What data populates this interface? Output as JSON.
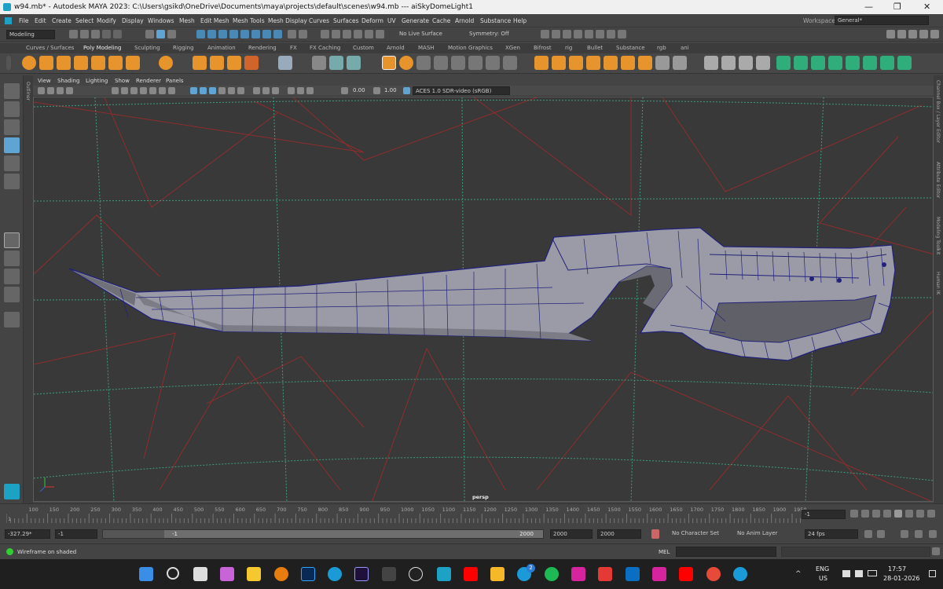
{
  "titlebar": {
    "title": "w94.mb* - Autodesk MAYA 2023: C:\\Users\\gsikd\\OneDrive\\Documents\\maya\\projects\\default\\scenes\\w94.mb   ---   aiSkyDomeLight1",
    "minimize": "—",
    "restore": "❐",
    "close": "✕"
  },
  "menu": [
    "File",
    "Edit",
    "Create",
    "Select",
    "Modify",
    "Display",
    "Windows",
    "Mesh",
    "Edit Mesh",
    "Mesh Tools",
    "Mesh Display",
    "Curves",
    "Surfaces",
    "Deform",
    "UV",
    "Generate",
    "Cache",
    "Arnold",
    "Substance",
    "Help"
  ],
  "workspace": {
    "label": "Workspace :",
    "value": "General*"
  },
  "status": {
    "mode": "Modeling",
    "live_surface": "No Live Surface",
    "symmetry": "Symmetry: Off"
  },
  "shelf_tabs": [
    "Curves / Surfaces",
    "Poly Modeling",
    "Sculpting",
    "Rigging",
    "Animation",
    "Rendering",
    "FX",
    "FX Caching",
    "Custom",
    "Arnold",
    "MASH",
    "Motion Graphics",
    "XGen",
    "Bifrost",
    "rig",
    "Bullet",
    "Substance",
    "rgb",
    "ani"
  ],
  "shelf_active": "Poly Modeling",
  "side_tabs": {
    "left": "Outliner",
    "right": [
      "Channel Box / Layer Editor",
      "Attribute Editor",
      "Modeling Toolkit",
      "Human IK"
    ]
  },
  "viewport": {
    "menu": [
      "View",
      "Shading",
      "Lighting",
      "Show",
      "Renderer",
      "Panels"
    ],
    "exposure": "0.00",
    "gamma": "1.00",
    "color_space": "ACES 1.0 SDR-video (sRGB)",
    "camera": "persp"
  },
  "timeline": {
    "ticks": [
      "1",
      "100",
      "150",
      "200",
      "250",
      "300",
      "350",
      "400",
      "450",
      "500",
      "550",
      "600",
      "650",
      "700",
      "750",
      "800",
      "850",
      "900",
      "950",
      "1000",
      "1050",
      "1100",
      "1150",
      "1200",
      "1250",
      "1300",
      "1350",
      "1400",
      "1450",
      "1500",
      "1550",
      "1600",
      "1650",
      "1700",
      "1750",
      "1800",
      "1850",
      "1900",
      "1950"
    ],
    "current_frame": "-1"
  },
  "range": {
    "start": "-327.29*",
    "playback_start": "-1",
    "slider_start": "-1",
    "slider_end": "2000",
    "playback_end": "2000",
    "end": "2000",
    "character_set": "No Character Set",
    "anim_layer": "No Anim Layer",
    "fps": "24 fps"
  },
  "cmd": {
    "lang": "MEL",
    "help": "Wireframe on shaded"
  },
  "tray": {
    "lang": "ENG",
    "region": "US",
    "time": "17:57",
    "date": "28-01-2026",
    "badge": "2"
  },
  "colors": {
    "accent": "#5fa4d3",
    "red_curve": "#b02a2a",
    "green_curve": "#3fae8c",
    "mesh": "#9a9ba6",
    "wire": "#22227a"
  }
}
